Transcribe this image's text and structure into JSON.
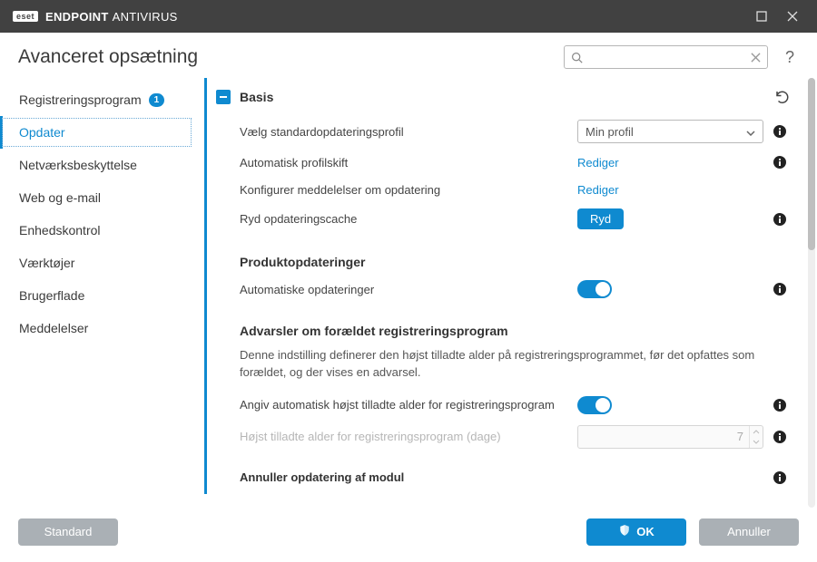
{
  "titlebar": {
    "brand_badge": "eset",
    "brand_strong": "ENDPOINT",
    "brand_light": "ANTIVIRUS"
  },
  "header": {
    "title": "Avanceret opsætning",
    "search_placeholder": ""
  },
  "sidebar": {
    "items": [
      {
        "label": "Registreringsprogram",
        "badge": "1",
        "active": false
      },
      {
        "label": "Opdater",
        "active": true
      },
      {
        "label": "Netværksbeskyttelse",
        "active": false
      },
      {
        "label": "Web og e-mail",
        "active": false
      },
      {
        "label": "Enhedskontrol",
        "active": false
      },
      {
        "label": "Værktøjer",
        "active": false
      },
      {
        "label": "Brugerflade",
        "active": false
      },
      {
        "label": "Meddelelser",
        "active": false
      }
    ]
  },
  "content": {
    "group_basis": {
      "title": "Basis",
      "profile_label": "Vælg standardopdateringsprofil",
      "profile_value": "Min profil",
      "autoswitch_label": "Automatisk profilskift",
      "autoswitch_action": "Rediger",
      "notify_label": "Konfigurer meddelelser om opdatering",
      "notify_action": "Rediger",
      "clearcache_label": "Ryd opdateringscache",
      "clearcache_action": "Ryd",
      "product_heading": "Produktopdateringer",
      "autoupdate_label": "Automatiske opdateringer",
      "outdated_heading": "Advarsler om forældet registreringsprogram",
      "outdated_desc": "Denne indstilling definerer den højst tilladte alder på registreringsprogrammet, før det opfattes som forældet, og der vises en advarsel.",
      "setage_label": "Angiv automatisk højst tilladte alder for registreringsprogram",
      "maxage_label": "Højst tilladte alder for registreringsprogram (dage)",
      "maxage_value": "7",
      "rollback_heading": "Annuller opdatering af modul"
    }
  },
  "footer": {
    "default": "Standard",
    "ok": "OK",
    "cancel": "Annuller"
  }
}
